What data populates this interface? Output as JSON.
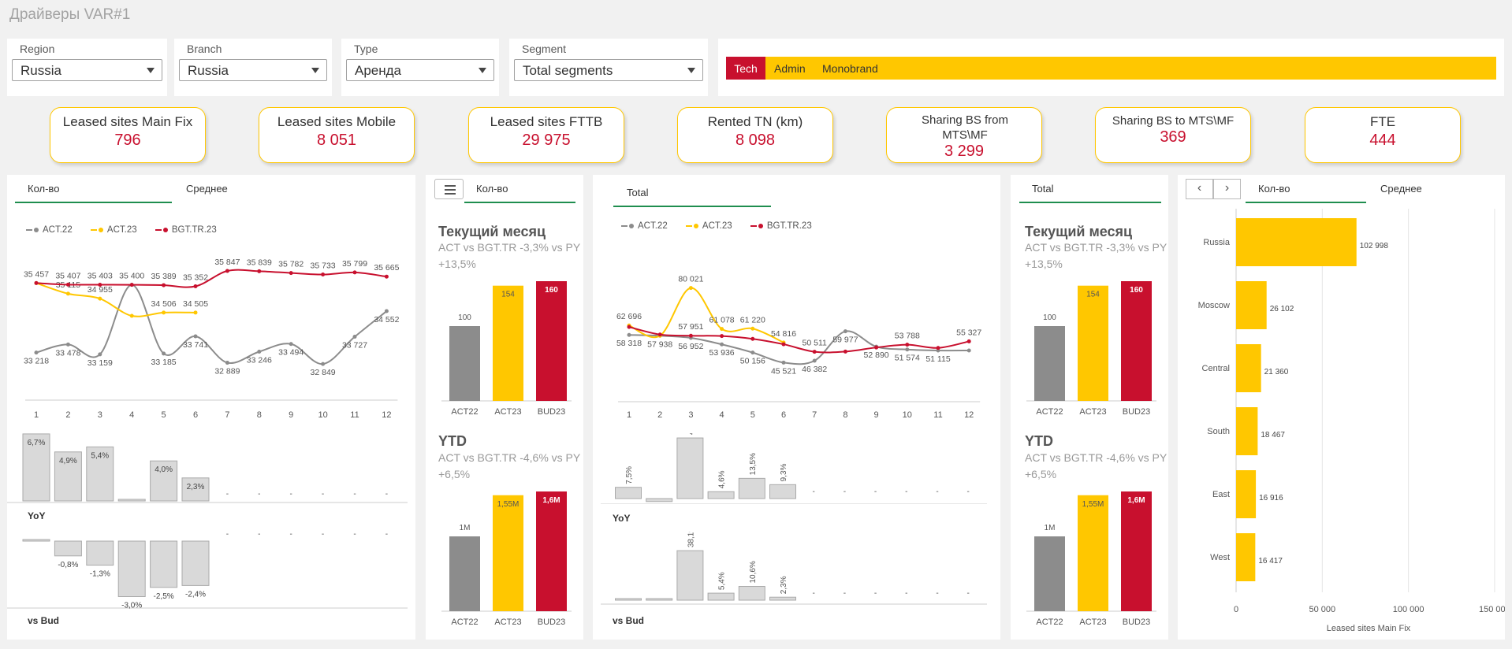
{
  "page": {
    "title": "Драйверы VAR#1"
  },
  "filters": [
    {
      "label": "Region",
      "value": "Russia"
    },
    {
      "label": "Branch",
      "value": "Russia"
    },
    {
      "label": "Type",
      "value": "Аренда"
    },
    {
      "label": "Segment",
      "value": "Total segments"
    }
  ],
  "tags": [
    {
      "label": "Tech",
      "active": true
    },
    {
      "label": "Admin",
      "active": false
    },
    {
      "label": "Monobrand",
      "active": false
    }
  ],
  "kpis": [
    {
      "title": "Leased sites Main Fix",
      "value": "796"
    },
    {
      "title": "Leased sites Mobile",
      "value": "8 051"
    },
    {
      "title": "Leased sites FTTB",
      "value": "29 975"
    },
    {
      "title": "Rented TN (km)",
      "value": "8 098"
    },
    {
      "title": "Sharing BS from MTS\\MF",
      "value": "3 299"
    },
    {
      "title": "Sharing BS to MTS\\MF",
      "value": "369"
    },
    {
      "title": "FTE",
      "value": "444"
    }
  ],
  "colors": {
    "act22": "#8c8c8c",
    "act23": "#ffc700",
    "bgt": "#c8102e",
    "tabline": "#1f8e4f",
    "barbg": "#d9d9d9"
  },
  "panel1": {
    "tab_active": "Кол-во",
    "tab_inactive": "Среднее",
    "yoy_label": "YoY",
    "vsbud_label": "vs Bud"
  },
  "panel2": {
    "tab": "Кол-во",
    "menu_icon": "list-icon",
    "current_title": "Текущий месяц",
    "current_sub1": "ACT vs BGT.TR -3,3% vs PY",
    "current_sub2": "+13,5%",
    "ytd_title": "YTD",
    "ytd_sub1": "ACT vs BGT.TR -4,6% vs PY",
    "ytd_sub2": "+6,5%"
  },
  "panel3": {
    "tab": "Total",
    "yoy_label": "YoY",
    "vsbud_label": "vs Bud"
  },
  "panel4": {
    "tab": "Total",
    "current_title": "Текущий месяц",
    "current_sub1": "ACT vs BGT.TR -3,3% vs PY",
    "current_sub2": "+13,5%",
    "ytd_title": "YTD",
    "ytd_sub1": "ACT vs BGT.TR -4,6% vs PY",
    "ytd_sub2": "+6,5%"
  },
  "panel5": {
    "tab_active": "Кол-во",
    "tab_inactive": "Среднее",
    "prev_icon": "chevron-left-icon",
    "next_icon": "chevron-right-icon",
    "prev_glyph": "‹",
    "next_glyph": "›"
  },
  "chart_data": [
    {
      "id": "line1",
      "type": "line",
      "x": [
        "1",
        "2",
        "3",
        "4",
        "5",
        "6",
        "7",
        "8",
        "9",
        "10",
        "11",
        "12"
      ],
      "series": [
        {
          "name": "ACT.22",
          "values": [
            33218,
            33478,
            33159,
            35400,
            33185,
            33741,
            32889,
            33246,
            33494,
            32849,
            33727,
            34552
          ],
          "labels": [
            "33 218",
            "33 478",
            "33 159",
            "",
            "33 185",
            "33 741",
            "32 889",
            "33 246",
            "33 494",
            "32 849",
            "33 727",
            "34 552"
          ]
        },
        {
          "name": "ACT.23",
          "values": [
            35457,
            35115,
            34955,
            34400,
            34506,
            34505,
            null,
            null,
            null,
            null,
            null,
            null
          ],
          "labels": [
            "",
            "35 115",
            "34 955",
            "",
            "34 506",
            "34 505",
            "",
            "",
            "",
            "",
            "",
            ""
          ]
        },
        {
          "name": "BGT.TR.23",
          "values": [
            35457,
            35407,
            35403,
            35400,
            35389,
            35352,
            35847,
            35839,
            35782,
            35733,
            35799,
            35665
          ],
          "labels": [
            "35 457",
            "35 407",
            "35 403",
            "35 400",
            "35 389",
            "35 352",
            "35 847",
            "35 839",
            "35 782",
            "35 733",
            "35 799",
            "35 665"
          ]
        }
      ],
      "ylim": [
        32700,
        36000
      ]
    },
    {
      "id": "yoy1",
      "type": "bar",
      "categories": [
        "1",
        "2",
        "3",
        "4",
        "5",
        "6",
        "7",
        "8",
        "9",
        "10",
        "11",
        "12"
      ],
      "values": [
        6.7,
        4.9,
        5.4,
        0.1,
        4.0,
        2.3,
        null,
        null,
        null,
        null,
        null,
        null
      ],
      "labels": [
        "6,7%",
        "4,9%",
        "5,4%",
        "0,1%",
        "4,0%",
        "2,3%",
        "-",
        "-",
        "-",
        "-",
        "-",
        "-"
      ]
    },
    {
      "id": "bud1",
      "type": "bar",
      "categories": [
        "1",
        "2",
        "3",
        "4",
        "5",
        "6",
        "7",
        "8",
        "9",
        "10",
        "11",
        "12"
      ],
      "values": [
        0.0,
        -0.8,
        -1.3,
        -3.0,
        -2.5,
        -2.4,
        null,
        null,
        null,
        null,
        null,
        null
      ],
      "labels": [
        "",
        "-0,8%",
        "-1,3%",
        "-3,0%",
        "-2,5%",
        "-2,4%",
        "-",
        "-",
        "-",
        "-",
        "-",
        "-"
      ]
    },
    {
      "id": "bar_cur_a",
      "type": "bar",
      "categories": [
        "ACT22",
        "ACT23",
        "BUD23"
      ],
      "values": [
        100,
        154,
        160
      ],
      "labels": [
        "100",
        "154",
        "160"
      ]
    },
    {
      "id": "bar_ytd_a",
      "type": "bar",
      "categories": [
        "ACT22",
        "ACT23",
        "BUD23"
      ],
      "values": [
        1.0,
        1.55,
        1.6
      ],
      "labels": [
        "1M",
        "1,55M",
        "1,6M"
      ]
    },
    {
      "id": "line2",
      "type": "line",
      "x": [
        "1",
        "2",
        "3",
        "4",
        "5",
        "6",
        "7",
        "8",
        "9",
        "10",
        "11",
        "12"
      ],
      "series": [
        {
          "name": "ACT.22",
          "values": [
            58318,
            57938,
            56952,
            53936,
            50156,
            45521,
            46382,
            59977,
            52890,
            51574,
            51115,
            51115
          ],
          "labels": [
            "58 318",
            "57 938",
            "56 952",
            "53 936",
            "50 156",
            "45 521",
            "46 382",
            "59 977",
            "52 890",
            "51 574",
            "51 115",
            ""
          ]
        },
        {
          "name": "ACT.23",
          "values": [
            62696,
            57938,
            80021,
            61078,
            61220,
            54816,
            null,
            null,
            null,
            null,
            null,
            null
          ],
          "labels": [
            "62 696",
            "",
            "80 021",
            "61 078",
            "61 220",
            "54 816",
            "",
            "",
            "",
            "",
            "",
            ""
          ]
        },
        {
          "name": "BGT.TR.23",
          "values": [
            62000,
            58500,
            57951,
            57800,
            56500,
            54000,
            50511,
            50600,
            52500,
            53788,
            52300,
            55327
          ],
          "labels": [
            "",
            "",
            "57 951",
            "",
            "",
            "",
            "50 511",
            "",
            "",
            "53 788",
            "",
            "55 327"
          ]
        }
      ],
      "ylim": [
        42000,
        85000
      ]
    },
    {
      "id": "yoy2",
      "type": "bar",
      "categories": [
        "1",
        "2",
        "3",
        "4",
        "5",
        "6",
        "7",
        "8",
        "9",
        "10",
        "11",
        "12"
      ],
      "values": [
        7.5,
        -2.0,
        40.5,
        4.6,
        13.5,
        9.3,
        null,
        null,
        null,
        null,
        null,
        null
      ],
      "labels": [
        "7,5%",
        "",
        "40,5%",
        "4,6%",
        "13,5%",
        "9,3%",
        "-",
        "-",
        "-",
        "-",
        "-",
        "-"
      ]
    },
    {
      "id": "bud2",
      "type": "bar",
      "categories": [
        "1",
        "2",
        "3",
        "4",
        "5",
        "6",
        "7",
        "8",
        "9",
        "10",
        "11",
        "12"
      ],
      "values": [
        1.0,
        1.0,
        38.1,
        5.4,
        10.6,
        2.3,
        null,
        null,
        null,
        null,
        null,
        null
      ],
      "labels": [
        "",
        "",
        "38,1%",
        "5,4%",
        "10,6%",
        "2,3%",
        "-",
        "-",
        "-",
        "-",
        "-",
        "-"
      ]
    },
    {
      "id": "bar_cur_b",
      "type": "bar",
      "categories": [
        "ACT22",
        "ACT23",
        "BUD23"
      ],
      "values": [
        100,
        154,
        160
      ],
      "labels": [
        "100",
        "154",
        "160"
      ]
    },
    {
      "id": "bar_ytd_b",
      "type": "bar",
      "categories": [
        "ACT22",
        "ACT23",
        "BUD23"
      ],
      "values": [
        1.0,
        1.55,
        1.6
      ],
      "labels": [
        "1M",
        "1,55M",
        "1,6M"
      ]
    },
    {
      "id": "hbar",
      "type": "bar",
      "orientation": "horizontal",
      "categories": [
        "Russia",
        "Moscow",
        "Central",
        "South",
        "East",
        "West"
      ],
      "values": [
        102998,
        26102,
        21360,
        18467,
        16916,
        16417
      ],
      "labels": [
        "102 998",
        "26 102",
        "21 360",
        "18 467",
        "16 916",
        "16 417"
      ],
      "xlabel": "Leased sites Main Fix",
      "xticks": [
        "0",
        "50 000",
        "100 000",
        "150 000"
      ],
      "xlim": [
        0,
        150000
      ]
    }
  ]
}
